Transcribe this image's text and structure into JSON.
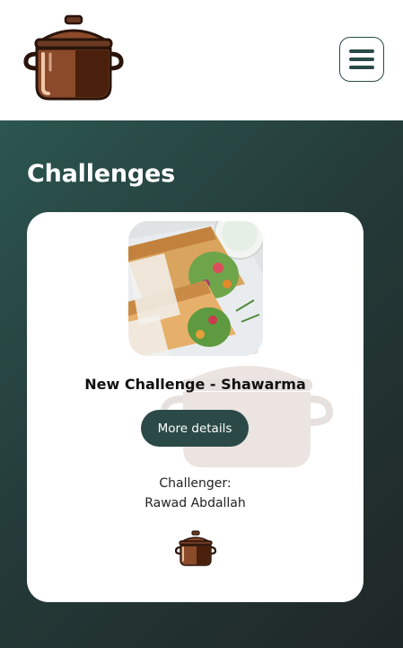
{
  "header": {
    "logo_icon": "cooking-pot-icon",
    "menu_icon": "hamburger-menu-icon",
    "accent_color": "#2b4a47"
  },
  "main": {
    "title": "Challenges",
    "cards": [
      {
        "image_icon": "shawarma-wrap-photo",
        "title": "New Challenge - Shawarma",
        "button_label": "More details",
        "challenger_label": "Challenger:",
        "challenger_name": "Rawad Abdallah",
        "footer_icon": "cooking-pot-icon"
      }
    ]
  }
}
